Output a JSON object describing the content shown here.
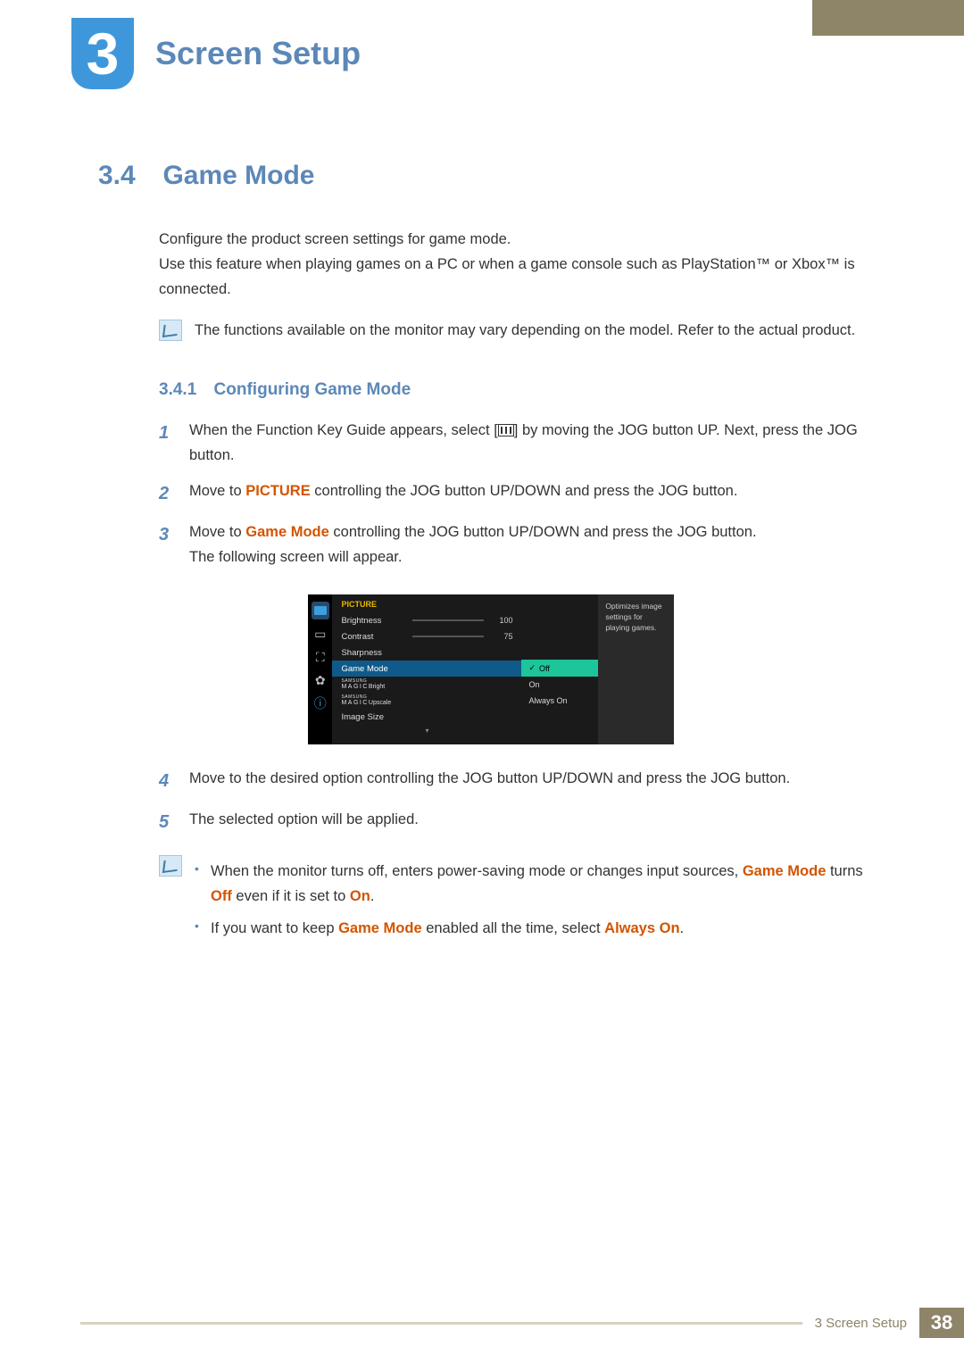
{
  "chapter": {
    "number": "3",
    "title": "Screen Setup"
  },
  "section": {
    "number": "3.4",
    "title": "Game Mode"
  },
  "intro": {
    "p1": "Configure the product screen settings for game mode.",
    "p2": "Use this feature when playing games on a PC or when a game console such as PlayStation™ or Xbox™ is connected."
  },
  "note1": "The functions available on the monitor may vary depending on the model. Refer to the actual product.",
  "subsection": {
    "number": "3.4.1",
    "title": "Configuring Game Mode"
  },
  "steps": {
    "s1a": "When the Function Key Guide appears, select [",
    "s1b": "] by moving the JOG button UP. Next, press the JOG button.",
    "s2a": "Move to ",
    "s2_kw": "PICTURE",
    "s2b": " controlling the JOG button UP/DOWN and press the JOG button.",
    "s3a": "Move to ",
    "s3_kw": "Game Mode",
    "s3b": " controlling the JOG button UP/DOWN and press the JOG button.",
    "s3c": "The following screen will appear.",
    "s4": "Move to the desired option controlling the JOG button UP/DOWN and press the JOG button.",
    "s5": "The selected option will be applied."
  },
  "osd": {
    "title": "PICTURE",
    "rows": {
      "brightness": {
        "label": "Brightness",
        "value": "100",
        "pct": 100
      },
      "contrast": {
        "label": "Contrast",
        "value": "75",
        "pct": 75
      },
      "sharpness": {
        "label": "Sharpness"
      },
      "gamemode": {
        "label": "Game Mode"
      },
      "magicbright": {
        "small": "SAMSUNG",
        "big": "MAGIC",
        "suffix": "Bright"
      },
      "magicupscale": {
        "small": "SAMSUNG",
        "big": "MAGIC",
        "suffix": "Upscale"
      },
      "imagesize": {
        "label": "Image Size"
      }
    },
    "options": {
      "off": "Off",
      "on": "On",
      "always": "Always On"
    },
    "help": "Optimizes image settings for playing games."
  },
  "note2": {
    "b1a": "When the monitor turns off, enters power-saving mode or changes input sources, ",
    "b1_kw1": "Game Mode",
    "b1b": " turns ",
    "b1_kw2": "Off",
    "b1c": " even if it is set to ",
    "b1_kw3": "On",
    "b1d": ".",
    "b2a": "If you want to keep ",
    "b2_kw1": "Game Mode",
    "b2b": " enabled all the time, select ",
    "b2_kw2": "Always On",
    "b2c": "."
  },
  "footer": {
    "chapter": "3 Screen Setup",
    "page": "38"
  }
}
